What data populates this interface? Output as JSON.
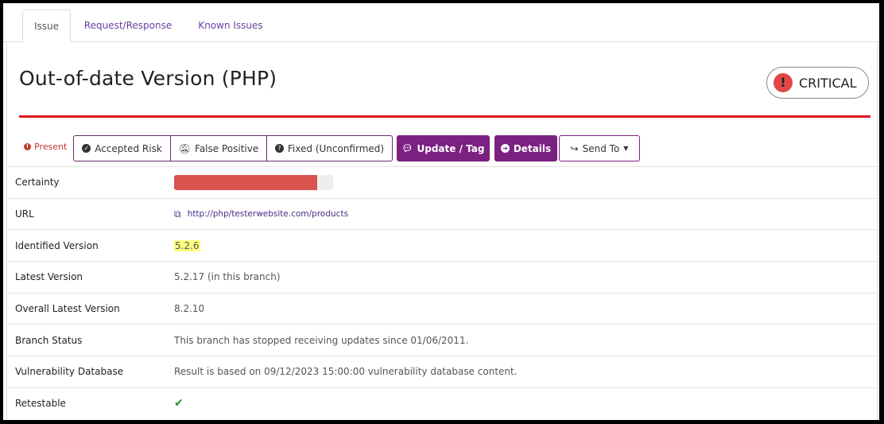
{
  "tabs": [
    {
      "label": "Issue",
      "active": true
    },
    {
      "label": "Request/Response",
      "active": false
    },
    {
      "label": "Known Issues",
      "active": false
    }
  ],
  "issue": {
    "title": "Out-of-date Version (PHP)",
    "severity": {
      "label": "CRITICAL",
      "icon": "exclamation-circle-icon",
      "color": "#e04848"
    }
  },
  "actions": {
    "present_label": "Present",
    "accepted_risk": "Accepted Risk",
    "false_positive": "False Positive",
    "fixed": "Fixed (Unconfirmed)",
    "update_tag": "Update / Tag",
    "details": "Details",
    "send_to": "Send To"
  },
  "details": {
    "certainty": {
      "label": "Certainty",
      "value": 0.9
    },
    "url": {
      "label": "URL",
      "value": "http://php/testerwebsite.com/products"
    },
    "identified_version": {
      "label": "Identified Version",
      "value": "5.2.6"
    },
    "latest_version": {
      "label": "Latest Version",
      "value": "5.2.17 (in this branch)"
    },
    "overall_latest_version": {
      "label": "Overall Latest Version",
      "value": "8.2.10"
    },
    "branch_status": {
      "label": "Branch Status",
      "value": "This branch has stopped receiving updates since 01/06/2011."
    },
    "vulnerability_database": {
      "label": "Vulnerability Database",
      "value": "Result is based on 09/12/2023 15:00:00 vulnerability database content."
    },
    "retestable": {
      "label": "Retestable",
      "value": "✔"
    }
  },
  "colors": {
    "accent": "#7b2181",
    "critical": "#e0181e",
    "certainty_bar": "#d9534f",
    "highlight": "#ffff80"
  }
}
